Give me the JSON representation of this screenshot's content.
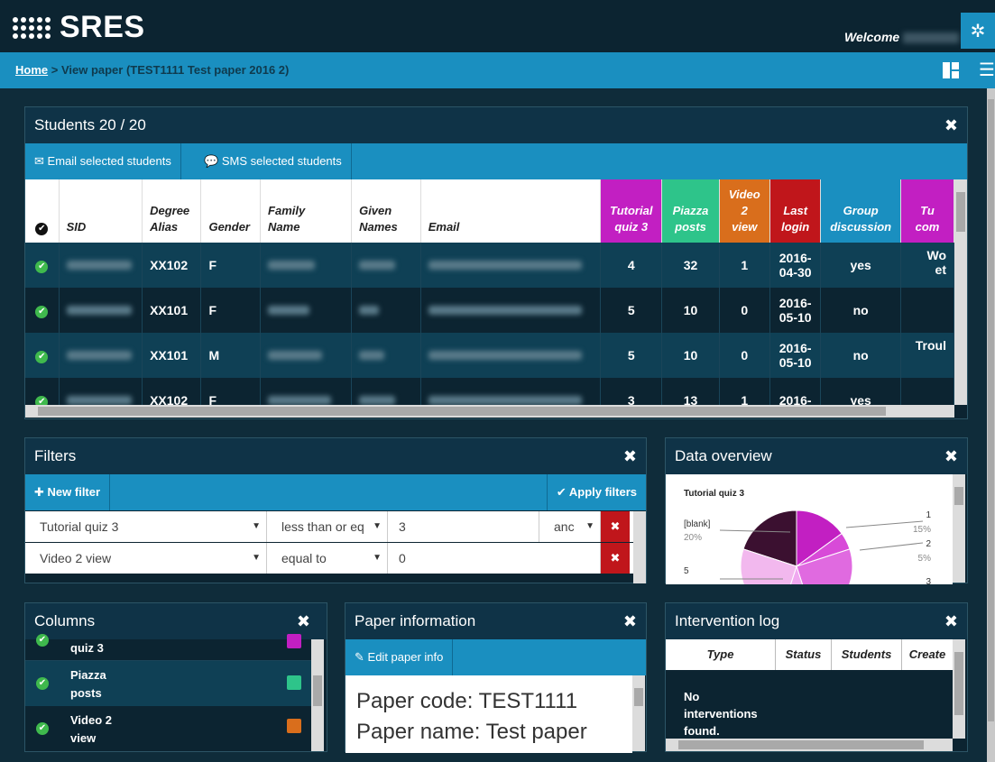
{
  "app": {
    "logo_text": "SRES",
    "welcome_label": "Welcome"
  },
  "breadcrumb": {
    "home": "Home",
    "current": " > View paper (TEST1111 Test paper 2016 2)"
  },
  "students_panel": {
    "title": "Students 20 / 20",
    "email_btn": "Email selected students",
    "sms_btn": "SMS selected students",
    "headers": {
      "sid": "SID",
      "degree1": "Degree",
      "degree2": "Alias",
      "gender": "Gender",
      "family1": "Family",
      "family2": "Name",
      "given1": "Given",
      "given2": "Names",
      "email": "Email",
      "tq1": "Tutorial",
      "tq2": "quiz 3",
      "pp1": "Piazza",
      "pp2": "posts",
      "v1": "Video",
      "v2": "2",
      "v3": "view",
      "ll1": "Last",
      "ll2": "login",
      "gd1": "Group",
      "gd2": "discussion",
      "tc1": "Tu",
      "tc2": "com"
    },
    "header_colors": {
      "tutorial": "#c21fc2",
      "piazza": "#2ec48a",
      "video": "#d96e1c",
      "last_login": "#c0161b",
      "group": "#1a8fc0",
      "tcom": "#c21fc2"
    },
    "rows": [
      {
        "alias": "XX102",
        "gender": "F",
        "quiz": "4",
        "posts": "32",
        "video": "1",
        "login1": "2016-",
        "login2": "04-30",
        "group": "yes",
        "comment1": "Wo",
        "comment2": "et"
      },
      {
        "alias": "XX101",
        "gender": "F",
        "quiz": "5",
        "posts": "10",
        "video": "0",
        "login1": "2016-",
        "login2": "05-10",
        "group": "no",
        "comment1": "",
        "comment2": ""
      },
      {
        "alias": "XX101",
        "gender": "M",
        "quiz": "5",
        "posts": "10",
        "video": "0",
        "login1": "2016-",
        "login2": "05-10",
        "group": "no",
        "comment1": "Troul",
        "comment2": ""
      },
      {
        "alias": "XX102",
        "gender": "F",
        "quiz": "3",
        "posts": "13",
        "video": "1",
        "login1": "2016-",
        "login2": "",
        "group": "yes",
        "comment1": "",
        "comment2": ""
      }
    ]
  },
  "filters_panel": {
    "title": "Filters",
    "new_filter": "New filter",
    "apply_filters": "Apply filters",
    "rows": [
      {
        "column": "Tutorial quiz 3",
        "operator": "less than or eq",
        "value": "3",
        "join": "anc"
      },
      {
        "column": "Video 2 view",
        "operator": "equal to",
        "value": "0"
      }
    ]
  },
  "overview_panel": {
    "title": "Data overview",
    "chart_title": "Tutorial quiz 3",
    "labels": [
      {
        "name": "[blank]",
        "pct": "20%"
      },
      {
        "name": "1",
        "pct": "15%"
      },
      {
        "name": "2",
        "pct": "5%"
      },
      {
        "name": "5",
        "pct": ""
      },
      {
        "name": "3",
        "pct": ""
      }
    ]
  },
  "chart_data": {
    "type": "pie",
    "title": "Tutorial quiz 3",
    "slices": [
      {
        "label": "[blank]",
        "value": 20
      },
      {
        "label": "1",
        "value": 15
      },
      {
        "label": "2",
        "value": 5
      },
      {
        "label": "3",
        "value": null
      },
      {
        "label": "5",
        "value": null
      }
    ]
  },
  "columns_panel": {
    "title": "Columns",
    "items": [
      {
        "label1": "quiz 3",
        "label2": "",
        "color": "#c21fc2"
      },
      {
        "label1": "Piazza",
        "label2": "posts",
        "color": "#2ec48a"
      },
      {
        "label1": "Video 2",
        "label2": "view",
        "color": "#d96e1c"
      }
    ]
  },
  "paper_panel": {
    "title": "Paper information",
    "edit_btn": "Edit paper info",
    "code": "Paper code: TEST1111",
    "name": "Paper name: Test paper"
  },
  "intervention_panel": {
    "title": "Intervention log",
    "headers": {
      "type": "Type",
      "status": "Status",
      "students": "Students",
      "created": "Create"
    },
    "empty1": "No",
    "empty2": "interventions",
    "empty3": "found."
  }
}
